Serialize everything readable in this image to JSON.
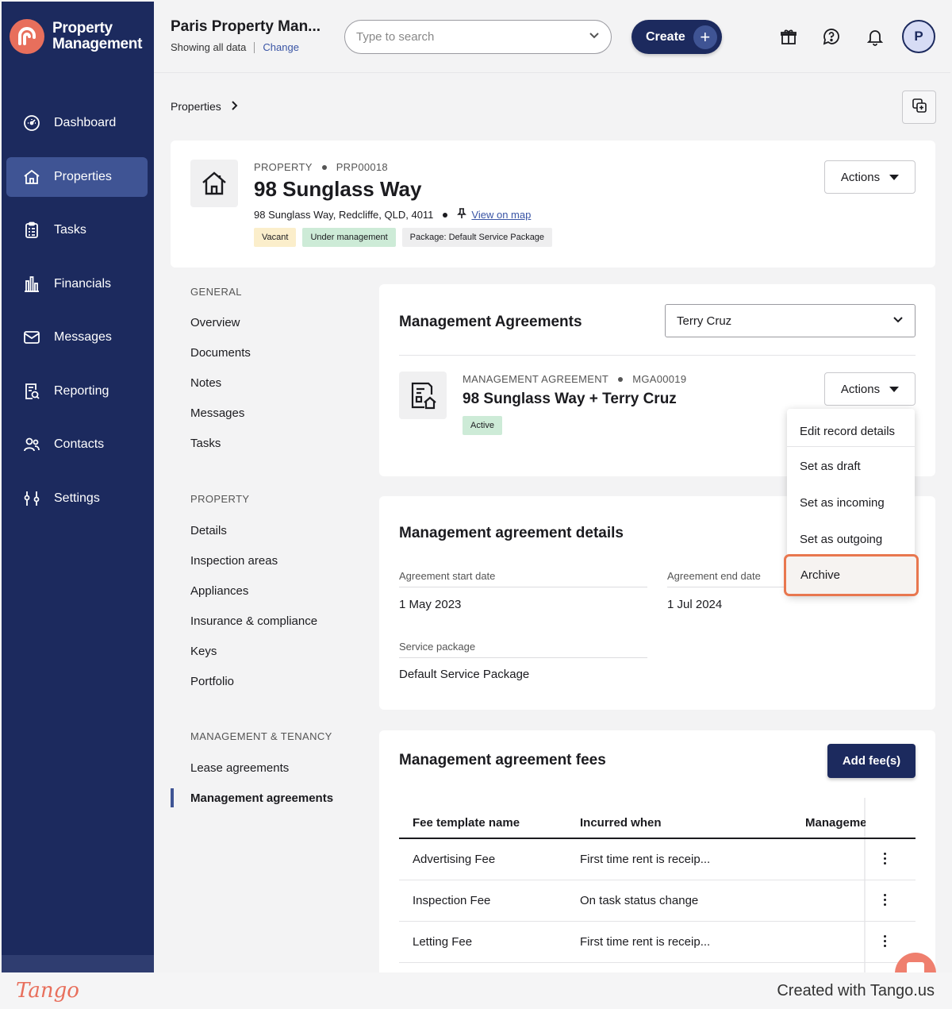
{
  "app": {
    "logo_line1": "Property",
    "logo_line2": "Management"
  },
  "sidebar": {
    "items": [
      {
        "label": "Dashboard",
        "icon": "dashboard-icon"
      },
      {
        "label": "Properties",
        "icon": "home-icon",
        "active": true
      },
      {
        "label": "Tasks",
        "icon": "clipboard-icon"
      },
      {
        "label": "Financials",
        "icon": "bar-chart-icon"
      },
      {
        "label": "Messages",
        "icon": "envelope-icon"
      },
      {
        "label": "Reporting",
        "icon": "report-search-icon"
      },
      {
        "label": "Contacts",
        "icon": "users-icon"
      },
      {
        "label": "Settings",
        "icon": "sliders-icon"
      }
    ]
  },
  "header": {
    "org_title": "Paris Property Man...",
    "showing": "Showing all data",
    "change": "Change",
    "search_placeholder": "Type to search",
    "create": "Create",
    "avatar_initial": "P"
  },
  "breadcrumb": {
    "item": "Properties"
  },
  "property": {
    "type": "PROPERTY",
    "code": "PRP00018",
    "title": "98 Sunglass Way",
    "address": "98 Sunglass Way, Redcliffe, QLD, 4011",
    "map_link": "View on map",
    "badges": [
      {
        "label": "Vacant",
        "color": "#fbeecb"
      },
      {
        "label": "Under management",
        "color": "#cdebd7"
      },
      {
        "label": "Package: Default Service Package",
        "color": "#eeeeef"
      }
    ],
    "actions": "Actions"
  },
  "subnav": {
    "general_header": "GENERAL",
    "general": [
      "Overview",
      "Documents",
      "Notes",
      "Messages",
      "Tasks"
    ],
    "property_header": "PROPERTY",
    "property": [
      "Details",
      "Inspection areas",
      "Appliances",
      "Insurance & compliance",
      "Keys",
      "Portfolio"
    ],
    "mgmt_header": "MANAGEMENT & TENANCY",
    "mgmt": [
      "Lease agreements",
      "Management agreements"
    ]
  },
  "agreements": {
    "title": "Management Agreements",
    "owner_select": "Terry Cruz",
    "type": "MANAGEMENT AGREEMENT",
    "code": "MGA00019",
    "name": "98 Sunglass Way + Terry Cruz",
    "status": "Active",
    "actions": "Actions"
  },
  "dropdown": {
    "items": [
      "Edit record details",
      "Set as draft",
      "Set as incoming",
      "Set as outgoing",
      "Archive"
    ]
  },
  "details": {
    "title": "Management agreement details",
    "start_label": "Agreement start date",
    "start_value": "1 May 2023",
    "end_label": "Agreement end date",
    "end_value": "1 Jul 2024",
    "package_label": "Service package",
    "package_value": "Default Service Package"
  },
  "fees": {
    "title": "Management agreement fees",
    "add": "Add fee(s)",
    "columns": [
      "Fee template name",
      "Incurred when",
      "Manageme"
    ],
    "rows": [
      {
        "name": "Advertising Fee",
        "when": "First time rent is receip..."
      },
      {
        "name": "Inspection Fee",
        "when": "On task status change"
      },
      {
        "name": "Letting Fee",
        "when": "First time rent is receip..."
      }
    ]
  },
  "footer": {
    "logo": "Tango",
    "credit": "Created with Tango.us"
  },
  "colors": {
    "sidebar": "#1c2a5e",
    "accent": "#3f5494",
    "brand": "#e86f5c",
    "highlight": "#e8774f"
  }
}
